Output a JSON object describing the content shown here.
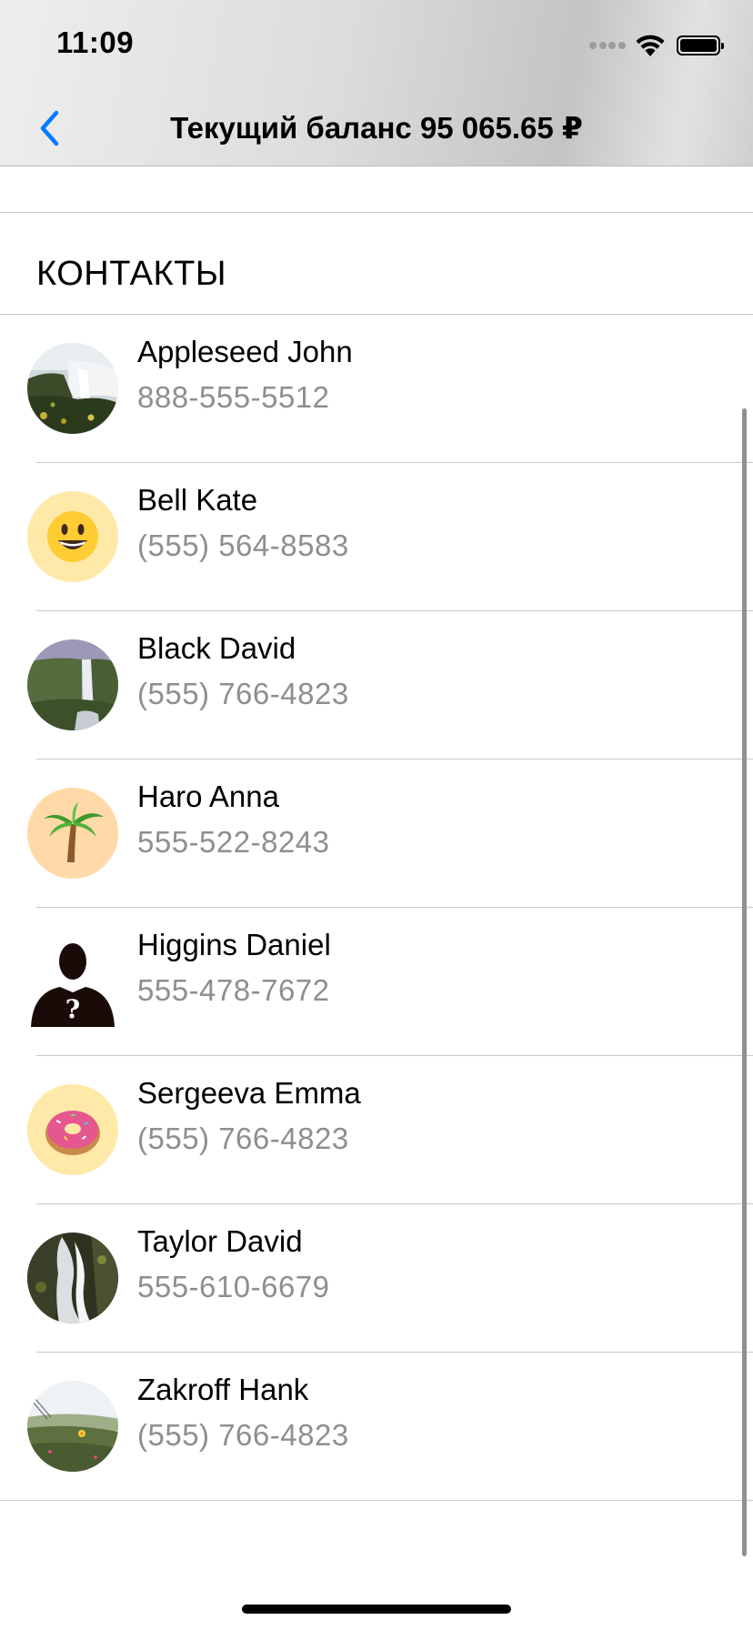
{
  "status_bar": {
    "time": "11:09",
    "icons": [
      "cellular-signal-icon",
      "wifi-icon",
      "battery-icon"
    ]
  },
  "nav": {
    "back_icon": "chevron-left-icon",
    "title": "Текущий баланс 95 065.65 ₽"
  },
  "section": {
    "header": "КОНТАКТЫ"
  },
  "contacts": [
    {
      "name": "Appleseed John",
      "phone": "888-555-5512",
      "avatar": "waterfall-photo"
    },
    {
      "name": "Bell Kate",
      "phone": "(555) 564-8583",
      "avatar": "grinning-face-emoji"
    },
    {
      "name": "Black David",
      "phone": "(555) 766-4823",
      "avatar": "waterfall-photo"
    },
    {
      "name": "Haro Anna",
      "phone": "555-522-8243",
      "avatar": "palm-tree-emoji"
    },
    {
      "name": "Higgins Daniel",
      "phone": "555-478-7672",
      "avatar": "unknown-person-silhouette"
    },
    {
      "name": "Sergeeva Emma",
      "phone": "(555) 766-4823",
      "avatar": "doughnut-emoji"
    },
    {
      "name": "Taylor David",
      "phone": "555-610-6679",
      "avatar": "waterfall-photo"
    },
    {
      "name": "Zakroff Hank",
      "phone": "(555) 766-4823",
      "avatar": "flower-field-photo"
    }
  ],
  "colors": {
    "accent": "#007AFF",
    "secondary_text": "#8E8E93",
    "separator": "#C8C7CC",
    "emoji_avatar_yellow": "#FFE9A8",
    "emoji_avatar_peach": "#FFD9A8"
  }
}
